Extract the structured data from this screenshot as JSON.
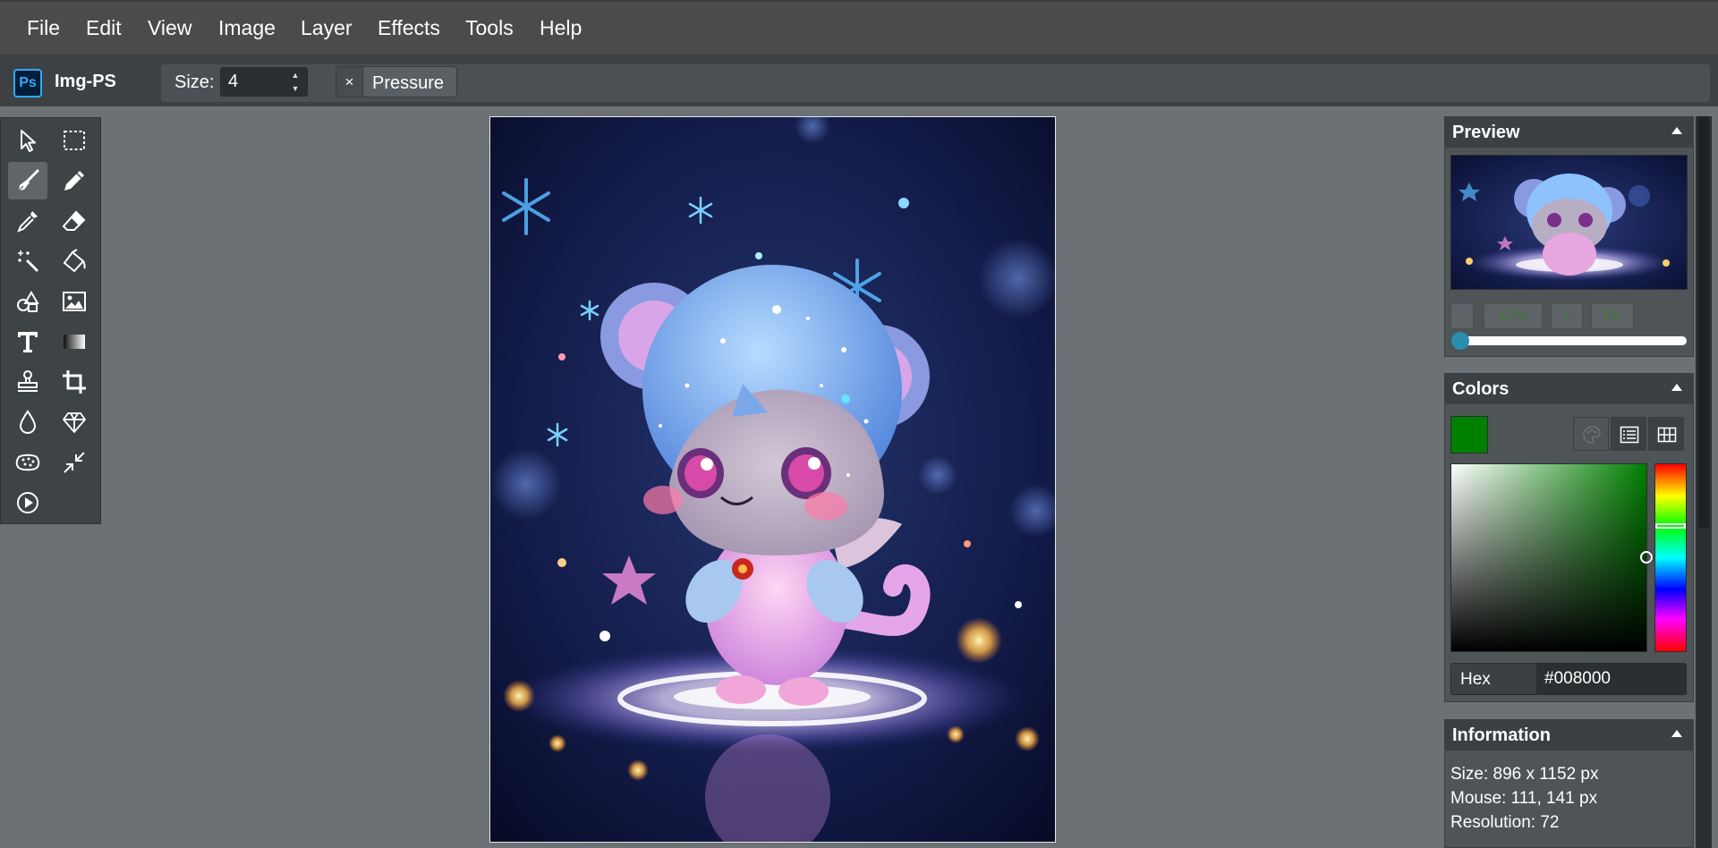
{
  "menu": {
    "items": [
      "File",
      "Edit",
      "View",
      "Image",
      "Layer",
      "Effects",
      "Tools",
      "Help"
    ]
  },
  "app": {
    "logo_text": "Ps",
    "name": "Img-PS"
  },
  "options": {
    "size_label": "Size:",
    "size_value": "4",
    "pressure_x": "×",
    "pressure_label": "Pressure"
  },
  "tools": [
    {
      "name": "select-tool-icon",
      "active": false
    },
    {
      "name": "marquee-tool-icon",
      "active": false
    },
    {
      "name": "brush-tool-icon",
      "active": true
    },
    {
      "name": "pencil-tool-icon",
      "active": false
    },
    {
      "name": "eyedropper-tool-icon",
      "active": false
    },
    {
      "name": "eraser-tool-icon",
      "active": false
    },
    {
      "name": "magic-wand-tool-icon",
      "active": false
    },
    {
      "name": "fill-bucket-tool-icon",
      "active": false
    },
    {
      "name": "shapes-tool-icon",
      "active": false
    },
    {
      "name": "image-tool-icon",
      "active": false
    },
    {
      "name": "text-tool-icon",
      "active": false
    },
    {
      "name": "gradient-tool-icon",
      "active": false
    },
    {
      "name": "clone-stamp-tool-icon",
      "active": false
    },
    {
      "name": "crop-tool-icon",
      "active": false
    },
    {
      "name": "blur-tool-icon",
      "active": false
    },
    {
      "name": "sharpen-tool-icon",
      "active": false
    },
    {
      "name": "sponge-tool-icon",
      "active": false
    },
    {
      "name": "resize-tool-icon",
      "active": false
    },
    {
      "name": "animation-play-tool-icon",
      "active": false
    }
  ],
  "preview": {
    "title": "Preview",
    "zoom_out": "-",
    "zoom_level": "47%",
    "zoom_in": "+",
    "fit": "Fit",
    "zoom_slider_value": 0
  },
  "colors": {
    "title": "Colors",
    "current_color": "#008000",
    "hex_label": "Hex",
    "hex_value": "#008000",
    "hue_marker_fraction": 0.333
  },
  "information": {
    "title": "Information",
    "size": "Size: 896 x 1152 px",
    "mouse": "Mouse: 111, 141 px",
    "resolution": "Resolution: 72"
  }
}
